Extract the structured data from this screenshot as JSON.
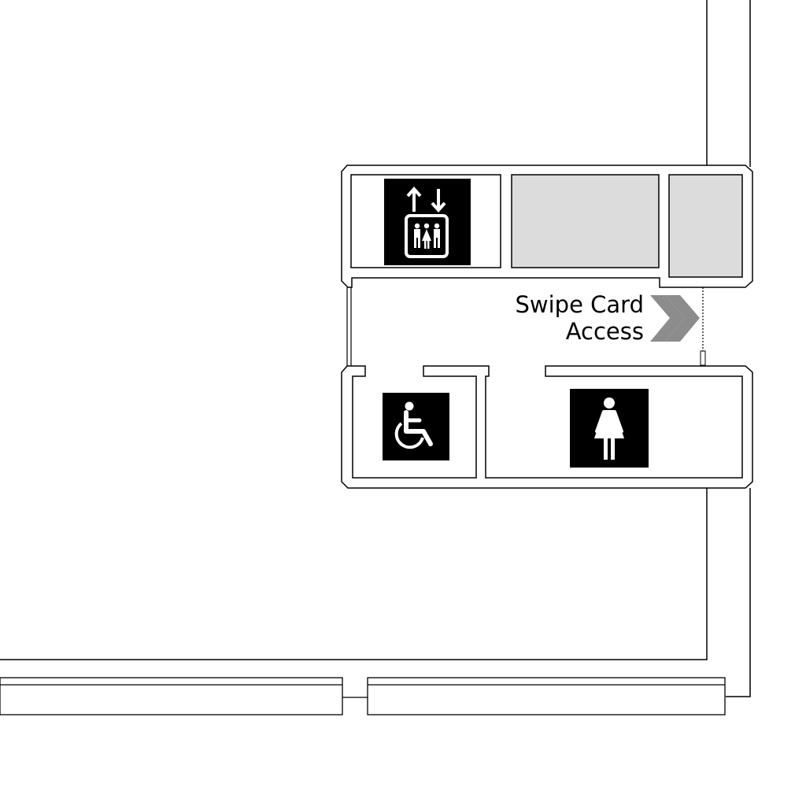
{
  "signs": {
    "swipe_line1": "Swipe Card",
    "swipe_line2": "Access"
  },
  "icons": {
    "elevator": "elevator-icon",
    "wheelchair": "wheelchair-accessible-icon",
    "female_restroom": "female-restroom-icon",
    "direction_chevron": "double-chevron-right-icon"
  },
  "colors": {
    "background": "#ffffff",
    "wall_line": "#000000",
    "room_fill_grey": "#dcdcdc",
    "chevron": "#8c8c8c",
    "icon_bg": "#000000",
    "icon_fg": "#ffffff"
  }
}
